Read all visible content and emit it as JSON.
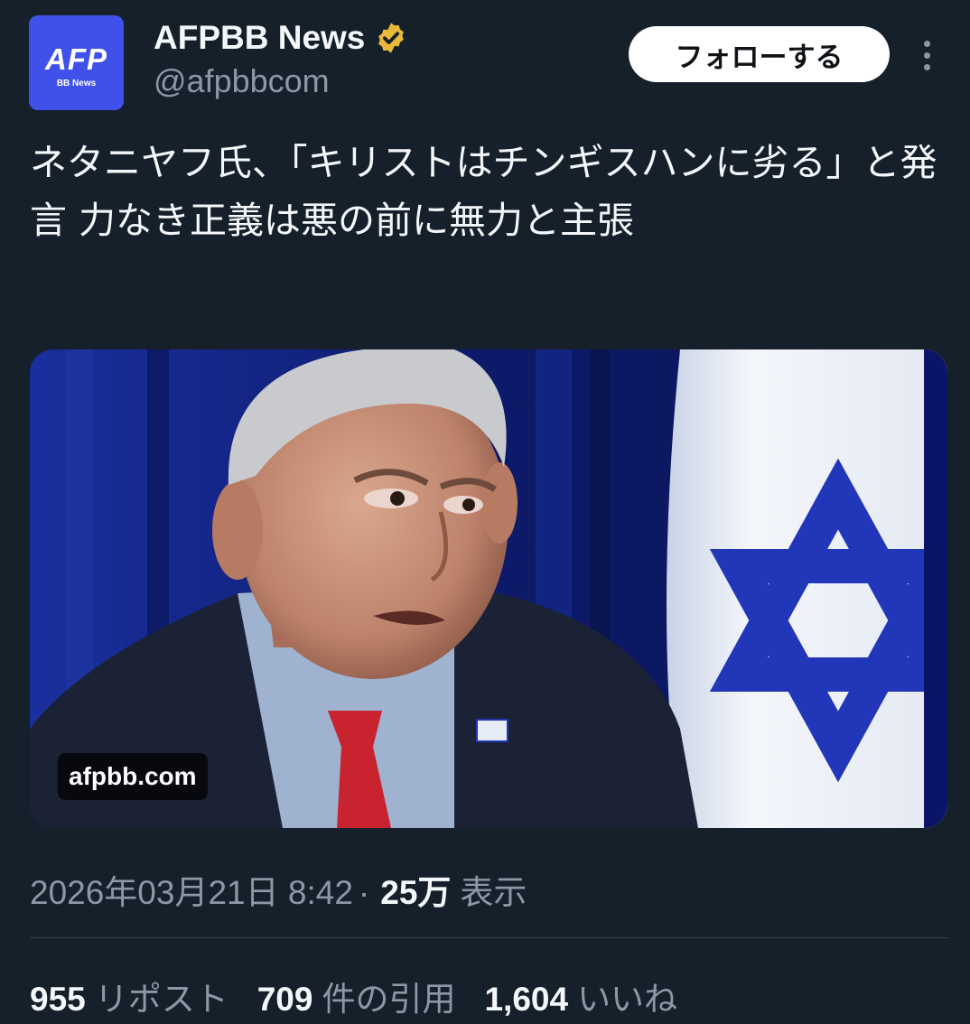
{
  "account": {
    "avatar_text": "AFP",
    "avatar_subtext": "BB News",
    "display_name": "AFPBB News",
    "handle": "@afpbbcom",
    "verified_icon": "verified-badge-icon",
    "brand_color": "#3f51e8",
    "badge_color": "#e9b93a"
  },
  "actions": {
    "follow_label": "フォローする",
    "more_icon": "more-vertical-icon"
  },
  "tweet": {
    "text": "ネタニヤフ氏、「キリストはチンギスハンに劣る」と発言 力なき正義は悪の前に無力と主張"
  },
  "media": {
    "domain_label": "afpbb.com"
  },
  "meta": {
    "timestamp": "2026年03月21日 8:42",
    "separator": "·",
    "views_count": "25万",
    "views_label": "表示"
  },
  "stats": [
    {
      "count": "955",
      "label": "リポスト"
    },
    {
      "count": "709",
      "label": "件の引用"
    },
    {
      "count": "1,604",
      "label": "いいね"
    }
  ]
}
